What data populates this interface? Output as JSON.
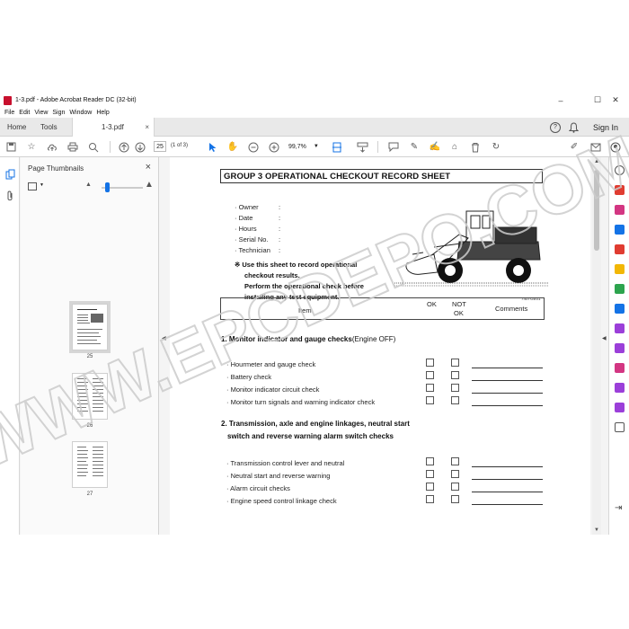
{
  "window": {
    "title": "1-3.pdf - Adobe Acrobat Reader DC (32-bit)",
    "controls": [
      "–",
      "☐",
      "✕"
    ]
  },
  "menu": [
    "File",
    "Edit",
    "View",
    "Sign",
    "Window",
    "Help"
  ],
  "tabs": {
    "home": "Home",
    "tools": "Tools",
    "document": "1-3.pdf",
    "close": "×"
  },
  "topright": {
    "help": "?",
    "bell": "🔔",
    "signin": "Sign In"
  },
  "toolbar": {
    "page_number": "25",
    "page_count": "(1 of 3)",
    "zoom": "99,7%"
  },
  "thumbnails": {
    "panel_title": "Page Thumbnails",
    "close": "×",
    "pages": [
      {
        "label": "25",
        "selected": true
      },
      {
        "label": "26",
        "selected": false
      },
      {
        "label": "27",
        "selected": false
      }
    ]
  },
  "document": {
    "heading": "GROUP 3  OPERATIONAL CHECKOUT RECORD SHEET",
    "info_fields": [
      "· Owner",
      "· Date",
      "· Hours",
      "· Serial No.",
      "· Technician"
    ],
    "info_colon": ":",
    "note_lines": [
      "※ Use this sheet to record operational",
      "checkout results.",
      "Perform the operational check before",
      "installing any test equipment."
    ],
    "figure_label": "7407GE01",
    "table_header": {
      "item": "Item",
      "ok": "OK",
      "not_ok_line1": "NOT",
      "not_ok_line2": "OK",
      "comments": "Comments"
    },
    "section1": {
      "title": "1. Monitor indicator and gauge checks",
      "suffix": "(Engine OFF)",
      "items": [
        "· Hourmeter and gauge check",
        "· Battery check",
        "· Monitor indicator circuit check",
        "· Monitor turn signals and  warning indicator check"
      ]
    },
    "section2": {
      "title_line1": "2. Transmission, axle and engine linkages, neutral start",
      "title_line2": "switch and reverse warning alarm switch checks",
      "items": [
        "· Transmission control lever and neutral",
        "· Neutral start and reverse warning",
        "· Alarm circuit checks",
        "· Engine speed control linkage check"
      ]
    }
  },
  "watermark": "WWW.EPCDEPO.COM",
  "colors": {
    "accent": "#1473e6",
    "brand_red": "#c8102e",
    "watermark": "#cfcfcf"
  }
}
